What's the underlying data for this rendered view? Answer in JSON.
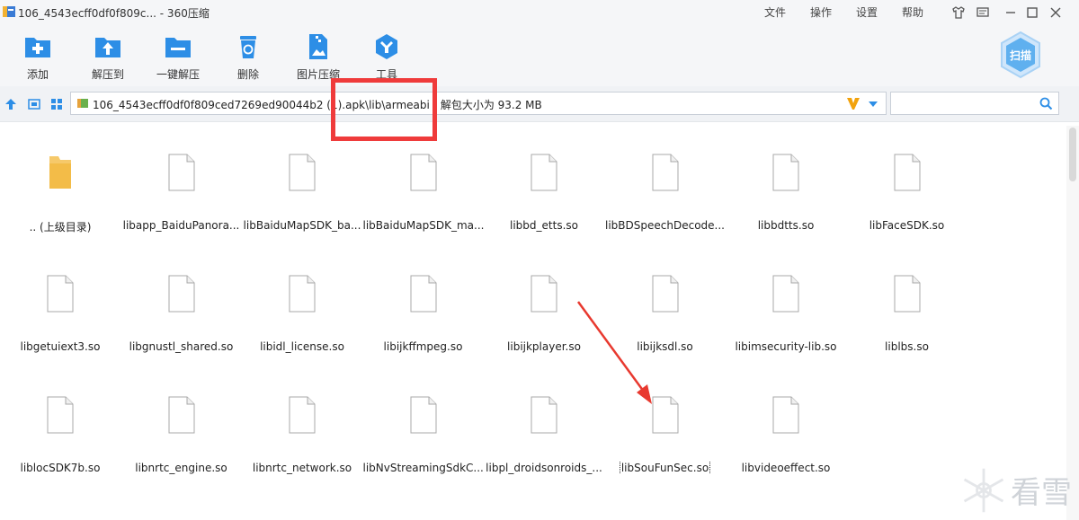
{
  "window": {
    "title": "106_4543ecff0df0f809c... - 360压缩"
  },
  "menu": [
    "文件",
    "操作",
    "设置",
    "帮助"
  ],
  "toolbar": {
    "tools": [
      {
        "label": "添加",
        "icon": "add-icon"
      },
      {
        "label": "解压到",
        "icon": "extract-to-icon"
      },
      {
        "label": "一键解压",
        "icon": "one-click-extract-icon"
      },
      {
        "label": "删除",
        "icon": "delete-icon"
      },
      {
        "label": "图片压缩",
        "icon": "image-compress-icon"
      },
      {
        "label": "工具",
        "icon": "tools-icon"
      }
    ],
    "scan_label": "扫描"
  },
  "address": {
    "path": "106_4543ecff0df0f809ced7269ed90044b2 (1).apk\\lib\\armeabi - 解包大小为 93.2 MB",
    "search_placeholder": ""
  },
  "files": [
    {
      "name": ".. (上级目录)",
      "type": "folder"
    },
    {
      "name": "libapp_BaiduPanora...",
      "type": "file"
    },
    {
      "name": "libBaiduMapSDK_ba...",
      "type": "file"
    },
    {
      "name": "libBaiduMapSDK_ma...",
      "type": "file"
    },
    {
      "name": "libbd_etts.so",
      "type": "file"
    },
    {
      "name": "libBDSpeechDecode...",
      "type": "file"
    },
    {
      "name": "libbdtts.so",
      "type": "file"
    },
    {
      "name": "libFaceSDK.so",
      "type": "file"
    },
    {
      "name": "libgetuiext3.so",
      "type": "file"
    },
    {
      "name": "libgnustl_shared.so",
      "type": "file"
    },
    {
      "name": "libidl_license.so",
      "type": "file"
    },
    {
      "name": "libijkffmpeg.so",
      "type": "file"
    },
    {
      "name": "libijkplayer.so",
      "type": "file"
    },
    {
      "name": "libijksdl.so",
      "type": "file"
    },
    {
      "name": "libimsecurity-lib.so",
      "type": "file"
    },
    {
      "name": "liblbs.so",
      "type": "file"
    },
    {
      "name": "liblocSDK7b.so",
      "type": "file"
    },
    {
      "name": "libnrtc_engine.so",
      "type": "file"
    },
    {
      "name": "libnrtc_network.so",
      "type": "file"
    },
    {
      "name": "libNvStreamingSdkC...",
      "type": "file"
    },
    {
      "name": "libpl_droidsonroids_...",
      "type": "file"
    },
    {
      "name": "libSouFunSec.so",
      "type": "file",
      "selected": true
    },
    {
      "name": "libvideoeffect.so",
      "type": "file"
    }
  ],
  "watermark": {
    "text": "看雪"
  },
  "colors": {
    "accent": "#2d8ee6",
    "highlight": "#ef3b3b",
    "arrow": "#e8392f"
  }
}
